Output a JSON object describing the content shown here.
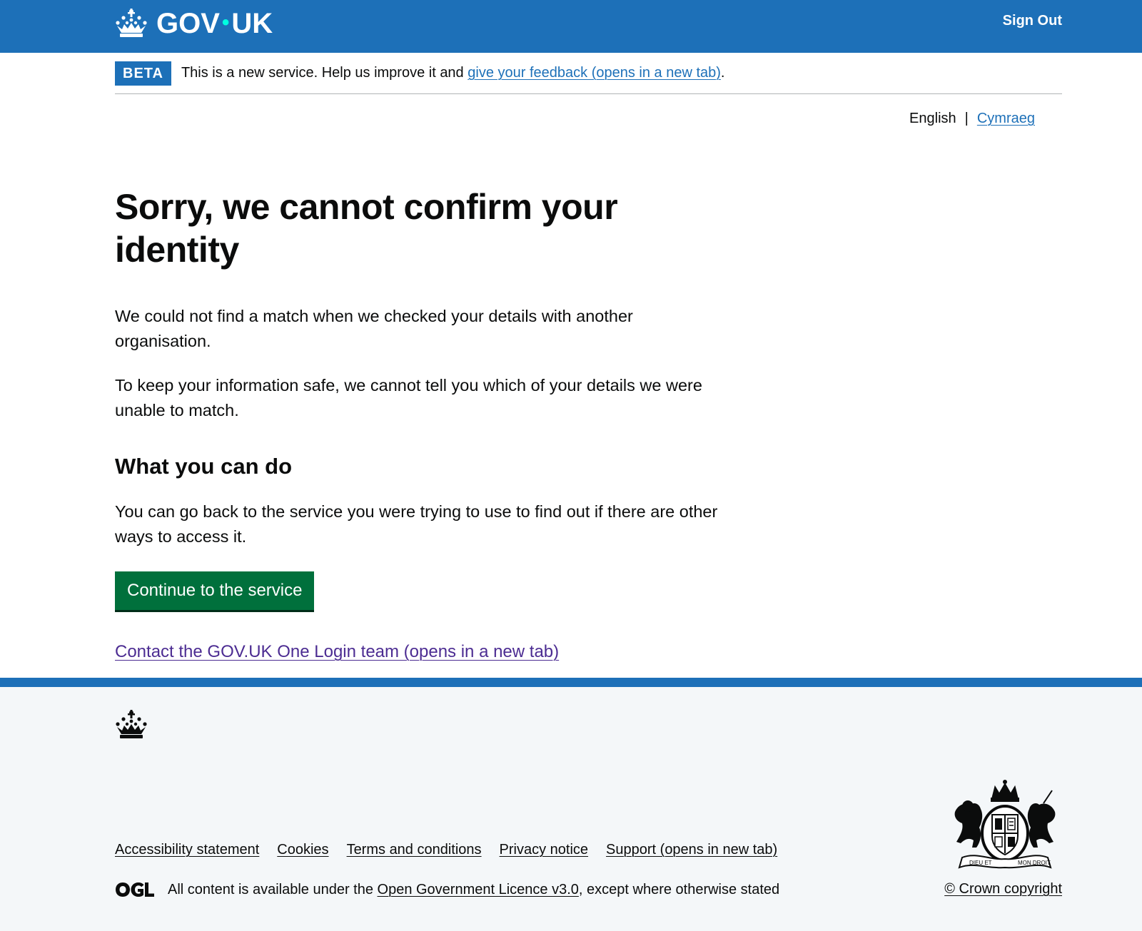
{
  "header": {
    "logo_text_left": "GOV",
    "logo_dot": "•",
    "logo_text_right": "UK",
    "sign_out": "Sign Out"
  },
  "phase_banner": {
    "tag": "BETA",
    "text": "This is a new service. Help us improve it and ",
    "link": "give your feedback (opens in a new tab)",
    "suffix": "."
  },
  "language": {
    "current": "English",
    "separator": "|",
    "alternate": "Cymraeg"
  },
  "main": {
    "title": "Sorry, we cannot confirm your identity",
    "para1": "We could not find a match when we checked your details with another organisation.",
    "para2": "To keep your information safe, we cannot tell you which of your details we were unable to match.",
    "subheading": "What you can do",
    "para3": "You can go back to the service you were trying to use to find out if there are other ways to access it.",
    "button": "Continue to the service",
    "contact_link": "Contact the GOV.UK One Login team (opens in a new tab)"
  },
  "footer": {
    "links": [
      "Accessibility statement",
      "Cookies",
      "Terms and conditions",
      "Privacy notice",
      "Support (opens in new tab)"
    ],
    "licence_prefix": "All content is available under the ",
    "licence_link": "Open Government Licence v3.0",
    "licence_suffix": ", except where otherwise stated",
    "copyright": "© Crown copyright",
    "crest_motto_left": "DIEU ET",
    "crest_motto_right": "MON DROIT"
  },
  "colors": {
    "brand_blue": "#1d70b8",
    "button_green": "#00703c",
    "visited_link": "#4c2c92",
    "footer_bg": "#f4f7f9"
  }
}
